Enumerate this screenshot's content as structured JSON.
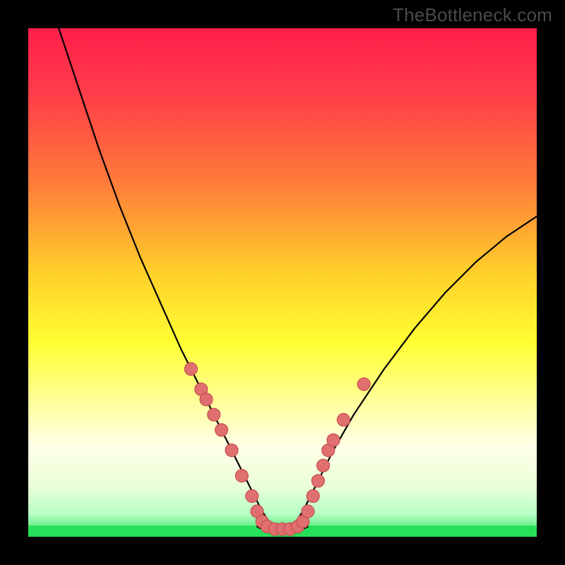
{
  "watermark": "TheBottleneck.com",
  "colors": {
    "black": "#000000",
    "curve": "#000000",
    "marker_fill": "#e06f6f",
    "marker_stroke": "#c84f4f",
    "green": "#26e05a",
    "gradient_stops": [
      {
        "offset": 0.0,
        "color": "#ff1f4a"
      },
      {
        "offset": 0.12,
        "color": "#ff3a4a"
      },
      {
        "offset": 0.3,
        "color": "#ff7a3a"
      },
      {
        "offset": 0.48,
        "color": "#ffcf2a"
      },
      {
        "offset": 0.62,
        "color": "#ffff33"
      },
      {
        "offset": 0.74,
        "color": "#ffffa0"
      },
      {
        "offset": 0.82,
        "color": "#ffffe6"
      },
      {
        "offset": 0.9,
        "color": "#eaffda"
      },
      {
        "offset": 0.955,
        "color": "#b8ffc5"
      },
      {
        "offset": 1.0,
        "color": "#26e05a"
      }
    ]
  },
  "chart_data": {
    "type": "line",
    "title": "",
    "xlabel": "",
    "ylabel": "",
    "xlim": [
      0,
      100
    ],
    "ylim": [
      0,
      100
    ],
    "grid": false,
    "legend": false,
    "series": [
      {
        "name": "left-curve",
        "x": [
          6,
          10,
          14,
          18,
          22,
          26,
          30,
          34,
          36,
          38,
          40,
          42,
          44,
          46,
          48
        ],
        "y": [
          100,
          88,
          76,
          65,
          55,
          46,
          37,
          29,
          25,
          21,
          17,
          13,
          9,
          5,
          2
        ]
      },
      {
        "name": "right-curve",
        "x": [
          52,
          54,
          56,
          58,
          60,
          64,
          70,
          76,
          82,
          88,
          94,
          100
        ],
        "y": [
          2,
          5,
          9,
          13,
          17,
          24,
          33,
          41,
          48,
          54,
          59,
          63
        ]
      },
      {
        "name": "valley-floor",
        "x": [
          45,
          47,
          49,
          51,
          53,
          55
        ],
        "y": [
          2,
          1,
          1,
          1,
          1,
          2
        ]
      }
    ],
    "markers": [
      {
        "x": 32,
        "y": 33
      },
      {
        "x": 34,
        "y": 29
      },
      {
        "x": 35,
        "y": 27
      },
      {
        "x": 36.5,
        "y": 24
      },
      {
        "x": 38,
        "y": 21
      },
      {
        "x": 40,
        "y": 17
      },
      {
        "x": 42,
        "y": 12
      },
      {
        "x": 44,
        "y": 8
      },
      {
        "x": 45,
        "y": 5
      },
      {
        "x": 46,
        "y": 3
      },
      {
        "x": 47,
        "y": 2
      },
      {
        "x": 48.5,
        "y": 1.5
      },
      {
        "x": 50,
        "y": 1.5
      },
      {
        "x": 51.5,
        "y": 1.5
      },
      {
        "x": 53,
        "y": 2
      },
      {
        "x": 54,
        "y": 3
      },
      {
        "x": 55,
        "y": 5
      },
      {
        "x": 56,
        "y": 8
      },
      {
        "x": 57,
        "y": 11
      },
      {
        "x": 58,
        "y": 14
      },
      {
        "x": 59,
        "y": 17
      },
      {
        "x": 60,
        "y": 19
      },
      {
        "x": 62,
        "y": 23
      },
      {
        "x": 66,
        "y": 30
      }
    ],
    "marker_radius_px": 9,
    "curve_stroke_px": 2.2,
    "green_band_height_pct": 2.2,
    "annotations": []
  }
}
